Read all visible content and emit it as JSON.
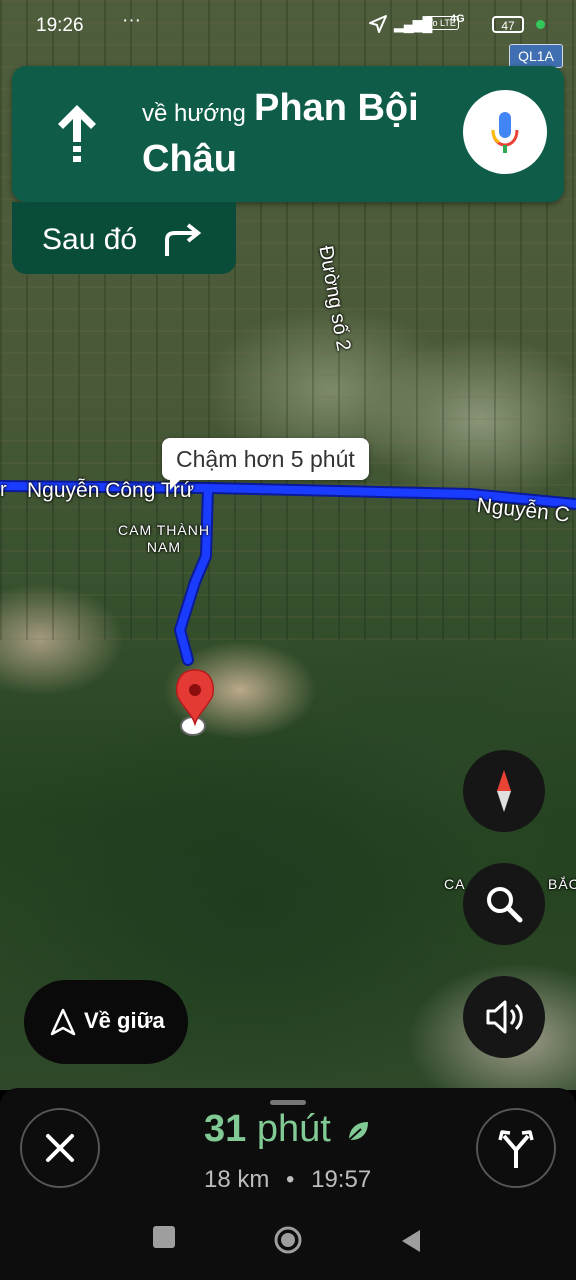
{
  "status_bar": {
    "time": "19:26",
    "dots": "···",
    "signal": "▂▄▆█",
    "volte": "Vo LTE",
    "network": "4G",
    "battery": "47"
  },
  "road_sign": "QL1A",
  "instruction": {
    "toward": "về hướng",
    "street_line1": "Phan Bội",
    "street_line2": "Châu",
    "then_label": "Sau đó"
  },
  "map": {
    "road_name_left": "Nguyễn Công Trứ",
    "road_name_left_fragment": "r",
    "road_name_right": "Nguyễn C",
    "road_vertical": "Đường số 2",
    "area_name": "CAM THÀNH\nNAM",
    "area_right_1": "CA",
    "area_right_2": "BẮC",
    "delay_callout": "Chậm hơn 5 phút",
    "route_color": "#1a3cff"
  },
  "controls": {
    "recenter_label": "Về giữa"
  },
  "trip": {
    "duration_value": "31",
    "duration_unit": "phút",
    "distance": "18 km",
    "separator": "•",
    "arrival": "19:57"
  },
  "colors": {
    "nav_card": "#0f5d48",
    "eta_green": "#81c995"
  }
}
